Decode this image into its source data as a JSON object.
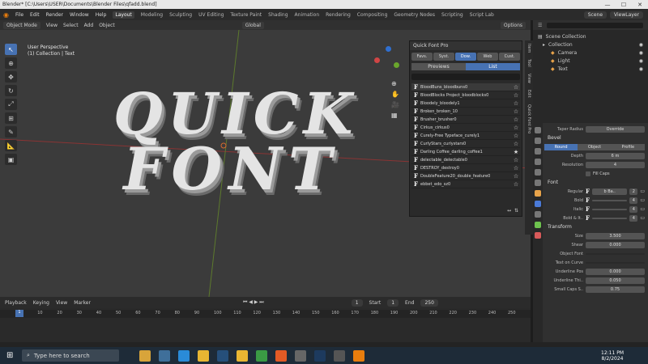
{
  "titlebar": {
    "text": "Blender* [C:\\Users\\USER\\Documents\\Blender Files\\qfadd.blend]",
    "min": "—",
    "max": "☐",
    "close": "✕"
  },
  "menu": {
    "items": [
      "File",
      "Edit",
      "Render",
      "Window",
      "Help"
    ]
  },
  "workspaces": [
    "Layout",
    "Modeling",
    "Sculpting",
    "UV Editing",
    "Texture Paint",
    "Shading",
    "Animation",
    "Rendering",
    "Compositing",
    "Geometry Nodes",
    "Scripting",
    "Script Lab"
  ],
  "topright": {
    "scene": "Scene",
    "viewlayer": "ViewLayer"
  },
  "viewport_header": {
    "mode": "Object Mode",
    "menus": [
      "View",
      "Select",
      "Add",
      "Object"
    ],
    "transform": "Global",
    "options": "Options"
  },
  "viewport": {
    "perspective": "User Perspective",
    "collection": "(1) Collection | Text",
    "text_line1": "QUICK",
    "text_line2": "FONT"
  },
  "quickfont": {
    "title": "Quick Font Pro",
    "tabs": [
      "Favs.",
      "Syst.",
      "Dow.",
      "Web",
      "Cust."
    ],
    "active_tab": "Dow.",
    "modes": [
      "Previews",
      "List"
    ],
    "fonts": [
      {
        "name": "BloodBuns_bloodbuns0",
        "starred": false,
        "hl": true
      },
      {
        "name": "BloodBlocks Project_bloodblocks0",
        "starred": false
      },
      {
        "name": "Bloodely_bloodely1",
        "starred": false
      },
      {
        "name": "Broken_broken_10",
        "starred": false
      },
      {
        "name": "Brusher_brusher0",
        "starred": false
      },
      {
        "name": "Cirkus_cirkus0",
        "starred": false
      },
      {
        "name": "Curely-Free Typeface_curely1",
        "starred": false
      },
      {
        "name": "CurlyStars_curlystars0",
        "starred": false
      },
      {
        "name": "Darling Coffee_darling_coffee1",
        "starred": true
      },
      {
        "name": "delectable_delectable0",
        "starred": false
      },
      {
        "name": "DESTROY_destroy0",
        "starred": false
      },
      {
        "name": "DoubleFeature20_double_feature0",
        "starred": false
      },
      {
        "name": "ebbet_edo_sz0",
        "starred": false
      }
    ]
  },
  "npanel_tabs": [
    "Item",
    "Tool",
    "View",
    "Edit",
    "Quick Font Pro"
  ],
  "outliner": {
    "title": "Scene Collection",
    "rows": [
      "Collection",
      "Camera",
      "Light",
      "Text"
    ]
  },
  "properties": {
    "taper": {
      "label": "Taper Radius",
      "value": "Override"
    },
    "bevel_title": "Bevel",
    "bevel_modes": [
      "Round",
      "Object",
      "Profile"
    ],
    "depth": {
      "label": "Depth",
      "value": "6 m"
    },
    "resolution": {
      "label": "Resolution",
      "value": "4"
    },
    "fill_caps": "Fill Caps",
    "font_title": "Font",
    "fonts": [
      {
        "label": "Regular",
        "value": "b Ba..",
        "num": "2"
      },
      {
        "label": "Bold",
        "value": "",
        "num": "4"
      },
      {
        "label": "Italic",
        "value": "",
        "num": "4"
      },
      {
        "label": "Bold & It..",
        "value": "",
        "num": "4"
      }
    ],
    "transform_title": "Transform",
    "size": {
      "label": "Size",
      "value": "3.500"
    },
    "shear": {
      "label": "Shear",
      "value": "0.000"
    },
    "object_font": "Object Font",
    "text_on_curve": "Text on Curve",
    "underline_pos": {
      "label": "Underline Pos",
      "value": "0.000"
    },
    "underline_thk": {
      "label": "Underline Thi..",
      "value": "0.050"
    },
    "small_caps": {
      "label": "Small Caps S..",
      "value": "0.75"
    }
  },
  "timeline": {
    "menus": [
      "Playback",
      "Keying",
      "View",
      "Marker"
    ],
    "current": "1",
    "start_label": "Start",
    "start": "1",
    "end_label": "End",
    "end": "250",
    "ticks": [
      "1",
      "10",
      "20",
      "30",
      "40",
      "50",
      "60",
      "70",
      "80",
      "90",
      "100",
      "110",
      "120",
      "130",
      "140",
      "150",
      "160",
      "170",
      "180",
      "190",
      "200",
      "210",
      "220",
      "230",
      "240",
      "250"
    ]
  },
  "taskbar": {
    "search": "Type here to search",
    "time": "12:11 PM",
    "date": "8/2/2024"
  }
}
